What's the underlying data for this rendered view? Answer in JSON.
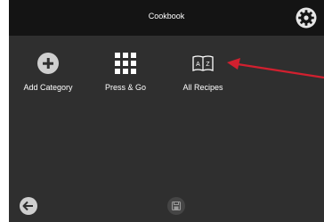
{
  "header": {
    "title": "Cookbook",
    "settings_icon": "gear-icon"
  },
  "menu": {
    "items": [
      {
        "label": "Add Category",
        "icon": "plus-circle-icon"
      },
      {
        "label": "Press & Go",
        "icon": "grid-icon"
      },
      {
        "label": "All Recipes",
        "icon": "book-az-icon"
      }
    ]
  },
  "footer": {
    "back_icon": "back-arrow-icon",
    "save_icon": "save-icon"
  },
  "colors": {
    "screen_bg": "#2f2f2f",
    "header_bg": "#141414",
    "icon_light": "#cfcfcf",
    "annotation_arrow": "#d1202f"
  }
}
